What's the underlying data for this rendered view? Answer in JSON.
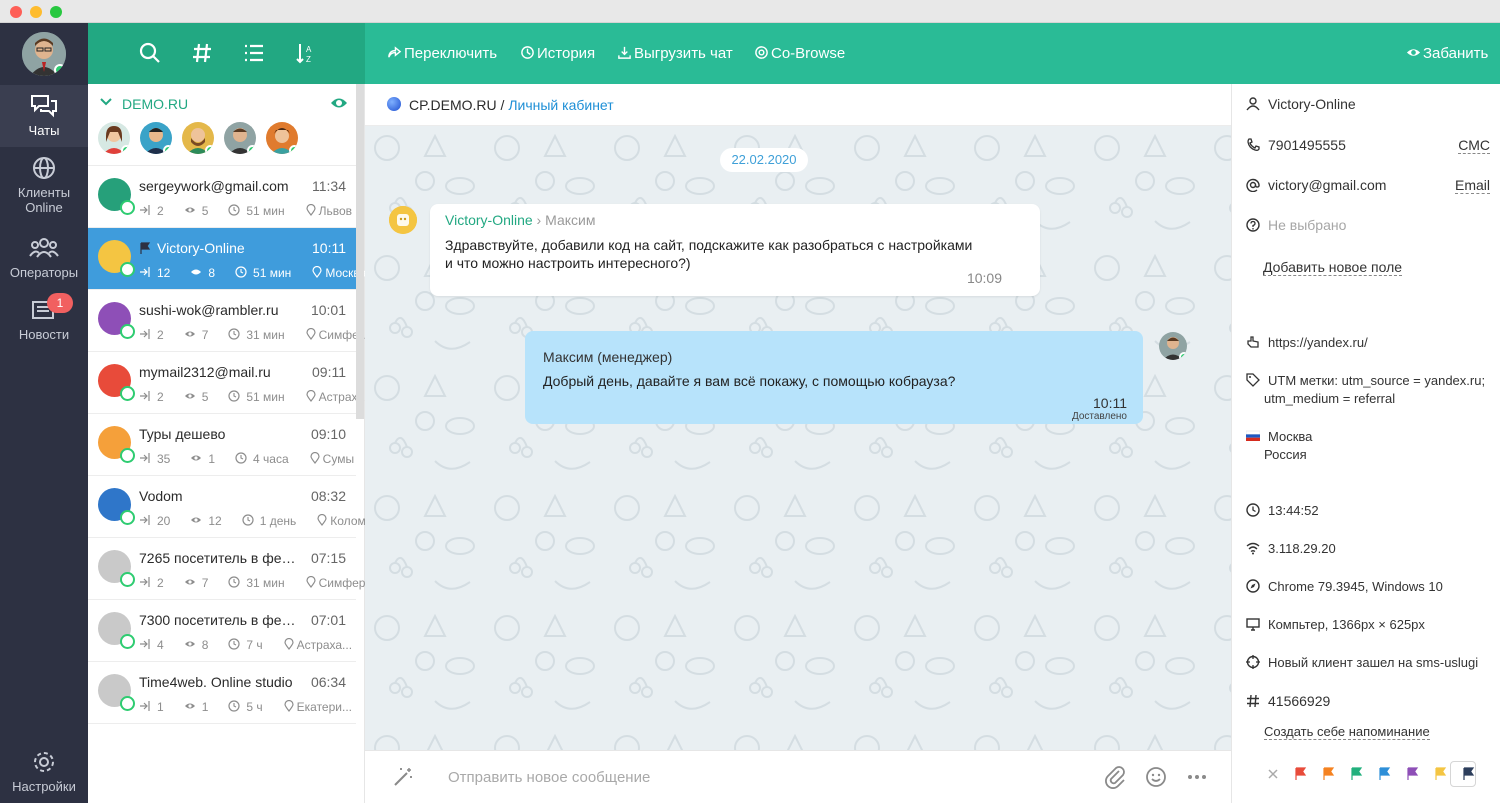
{
  "nav": {
    "items": [
      {
        "label": "Чаты",
        "icon": "chat-bubbles-icon"
      },
      {
        "label": "Клиенты Online",
        "icon": "globe-icon"
      },
      {
        "label": "Операторы",
        "icon": "people-icon"
      },
      {
        "label": "Новости",
        "icon": "newspaper-icon",
        "badge": "1"
      },
      {
        "label": "Настройки",
        "icon": "gear-icon"
      }
    ]
  },
  "list": {
    "group": "DEMO.RU",
    "chats": [
      {
        "name": "sergeywork@gmail.com",
        "time": "11:34",
        "in": "2",
        "views": "5",
        "dur": "51 мин",
        "city": "Львов",
        "color": "#26a07a"
      },
      {
        "name": "Victory-Online",
        "time": "10:11",
        "in": "12",
        "views": "8",
        "dur": "51 мин",
        "city": "Москва",
        "color": "#f4c542"
      },
      {
        "name": "sushi-wok@rambler.ru",
        "time": "10:01",
        "in": "2",
        "views": "7",
        "dur": "31 мин",
        "city": "Симфе...",
        "color": "#8e4fb7"
      },
      {
        "name": "mymail2312@mail.ru",
        "time": "09:11",
        "in": "2",
        "views": "5",
        "dur": "51 мин",
        "city": "Астраха...",
        "color": "#e84b3a"
      },
      {
        "name": "Туры дешево",
        "time": "09:10",
        "in": "35",
        "views": "1",
        "dur": "4 часа",
        "city": "Сумы",
        "color": "#f5a03a"
      },
      {
        "name": "Vodom",
        "time": "08:32",
        "in": "20",
        "views": "12",
        "dur": "1 день",
        "city": "Коломна",
        "color": "#2f76c9"
      },
      {
        "name": "7265 посетитель в февр...",
        "time": "07:15",
        "in": "2",
        "views": "7",
        "dur": "31 мин",
        "city": "Симфер...",
        "color": "#c9c9c9"
      },
      {
        "name": "7300 посетитель в февр...",
        "time": "07:01",
        "in": "4",
        "views": "8",
        "dur": "7 ч",
        "city": "Астраха...",
        "color": "#c9c9c9"
      },
      {
        "name": "Time4web. Online studio",
        "time": "06:34",
        "in": "1",
        "views": "1",
        "dur": "5 ч",
        "city": "Екатери...",
        "color": "#c9c9c9"
      }
    ]
  },
  "toolbar": {
    "switch": "Переключить",
    "history": "История",
    "export": "Выгрузить чат",
    "cobrowse": "Co-Browse",
    "ban": "Забанить"
  },
  "crumb": {
    "site": "CP.DEMO.RU",
    "sep": " / ",
    "page": "Личный кабинет"
  },
  "chat": {
    "date": "22.02.2020",
    "m1": {
      "from": "Victory-Online",
      "arrow": " › ",
      "to": "Максим",
      "line1": "Здравствуйте, добавили код на сайт, подскажите как разобраться с настройками",
      "line2": "и что можно настроить интересного?)",
      "time": "10:09"
    },
    "m2": {
      "from": "Максим (менеджер)",
      "text": "Добрый день, давайте я вам всё покажу, с помощью кобрауза?",
      "time": "10:11",
      "status": "Доставлено"
    }
  },
  "input": {
    "placeholder": "Отправить новое сообщение"
  },
  "info": {
    "name": "Victory-Online",
    "phone": "7901495555",
    "sms": "СМС",
    "email": "victory@gmail.com",
    "email_link": "Email",
    "not_selected": "Не выбрано",
    "add_field": "Добавить новое поле",
    "ref": "https://yandex.ru/",
    "utm1": "UTM метки: utm_source = yandex.ru;",
    "utm2": "utm_medium = referral",
    "city": "Москва",
    "country": "Россия",
    "clock": "13:44:52",
    "ip": "3.118.29.20",
    "browser": "Chrome 79.3945, Windows 10",
    "device": "Компьтер, 1366px  ×  625px",
    "newclient": "Новый клиент зашел на sms-uslugi",
    "id": "41566929",
    "reminder": "Создать себе напоминание",
    "flag_colors": [
      "#e84b3a",
      "#f58220",
      "#22b07d",
      "#2e8fd8",
      "#8e4fb7",
      "#f4c542",
      "#2d3e5c"
    ]
  },
  "colors": {
    "accent": "#2abb96",
    "accent_dark": "#22a882",
    "nav": "#2d3142",
    "active_row": "#3f9cdc",
    "bubble_out": "#b7e3fb"
  }
}
